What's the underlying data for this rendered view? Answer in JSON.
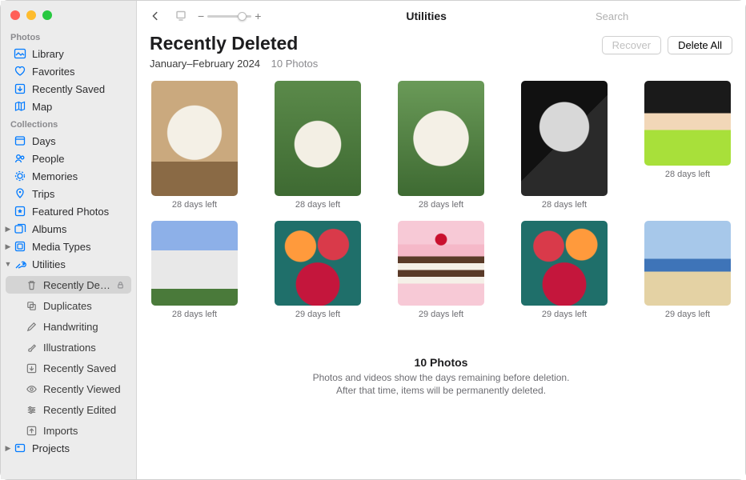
{
  "toolbar": {
    "title": "Utilities",
    "search_placeholder": "Search"
  },
  "header": {
    "title": "Recently Deleted",
    "date_range": "January–February 2024",
    "count_label": "10 Photos",
    "recover_label": "Recover",
    "delete_all_label": "Delete All"
  },
  "sidebar": {
    "sections": [
      {
        "label": "Photos",
        "items": [
          {
            "label": "Library"
          },
          {
            "label": "Favorites"
          },
          {
            "label": "Recently Saved"
          },
          {
            "label": "Map"
          }
        ]
      },
      {
        "label": "Collections",
        "items": [
          {
            "label": "Days"
          },
          {
            "label": "People"
          },
          {
            "label": "Memories"
          },
          {
            "label": "Trips"
          },
          {
            "label": "Featured Photos"
          },
          {
            "label": "Albums"
          },
          {
            "label": "Media Types"
          },
          {
            "label": "Utilities"
          }
        ]
      }
    ],
    "utilities_children": [
      {
        "label": "Recently Delet…"
      },
      {
        "label": "Duplicates"
      },
      {
        "label": "Handwriting"
      },
      {
        "label": "Illustrations"
      },
      {
        "label": "Recently Saved"
      },
      {
        "label": "Recently Viewed"
      },
      {
        "label": "Recently Edited"
      },
      {
        "label": "Imports"
      }
    ],
    "projects_label": "Projects"
  },
  "photos": [
    {
      "caption": "28 days left"
    },
    {
      "caption": "28 days left"
    },
    {
      "caption": "28 days left"
    },
    {
      "caption": "28 days left"
    },
    {
      "caption": "28 days left"
    },
    {
      "caption": "28 days left"
    },
    {
      "caption": "29 days left"
    },
    {
      "caption": "29 days left"
    },
    {
      "caption": "29 days left"
    },
    {
      "caption": "29 days left"
    }
  ],
  "footer": {
    "title": "10 Photos",
    "line1": "Photos and videos show the days remaining before deletion.",
    "line2": "After that time, items will be permanently deleted."
  }
}
